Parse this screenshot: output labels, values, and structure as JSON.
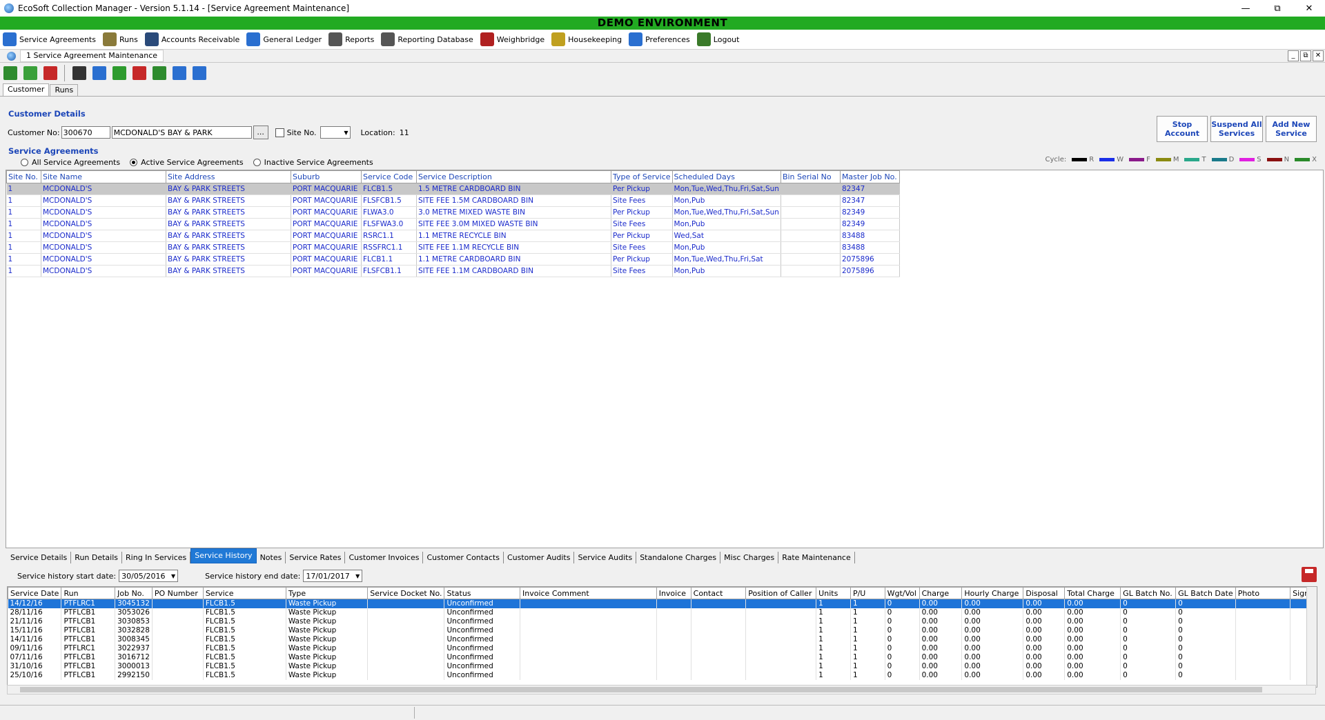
{
  "window": {
    "title": "EcoSoft Collection Manager - Version 5.1.14 - [Service Agreement Maintenance]"
  },
  "banner": "DEMO ENVIRONMENT",
  "menu": [
    {
      "label": "Service Agreements",
      "icon": "calendar-icon",
      "color": "#2a6fd0"
    },
    {
      "label": "Runs",
      "icon": "clipboard-icon",
      "color": "#8a7a3a"
    },
    {
      "label": "Accounts Receivable",
      "icon": "people-money-icon",
      "color": "#2a4a7a"
    },
    {
      "label": "General Ledger",
      "icon": "ledger-icon",
      "color": "#2a6fd0"
    },
    {
      "label": "Reports",
      "icon": "printer-icon",
      "color": "#555555"
    },
    {
      "label": "Reporting Database",
      "icon": "database-printer-icon",
      "color": "#555555"
    },
    {
      "label": "Weighbridge",
      "icon": "truck-icon",
      "color": "#b02020"
    },
    {
      "label": "Housekeeping",
      "icon": "gears-icon",
      "color": "#c0a020"
    },
    {
      "label": "Preferences",
      "icon": "checklist-icon",
      "color": "#2a6fd0"
    },
    {
      "label": "Logout",
      "icon": "exit-icon",
      "color": "#3a7a2a"
    }
  ],
  "mdi": {
    "tab": "1 Service Agreement Maintenance"
  },
  "toolbar": [
    {
      "icon": "add-customer-icon",
      "color": "#2e8b2e"
    },
    {
      "icon": "approve-icon",
      "color": "#3aa03a"
    },
    {
      "icon": "delete-icon",
      "color": "#c62828"
    },
    {
      "icon": "find-icon",
      "color": "#333333"
    },
    {
      "icon": "search-records-icon",
      "color": "#2a6fd0"
    },
    {
      "icon": "refresh-icon",
      "color": "#2e9b2e"
    },
    {
      "icon": "save-icon",
      "color": "#c62828"
    },
    {
      "icon": "edit-icon",
      "color": "#2e8b2e"
    },
    {
      "icon": "export-icon",
      "color": "#2a6fd0"
    },
    {
      "icon": "screen-icon",
      "color": "#2a6fd0"
    }
  ],
  "subtabs": [
    "Customer",
    "Runs"
  ],
  "customer": {
    "section": "Customer Details",
    "no_label": "Customer No:",
    "no_value": "300670",
    "name_value": "MCDONALD'S BAY & PARK",
    "browse_label": "...",
    "site_label": "Site No.",
    "location_label": "Location:",
    "location_value": "11"
  },
  "actions": {
    "stop": "Stop Account",
    "suspend": "Suspend All Services",
    "add": "Add New Service"
  },
  "agreements": {
    "section": "Service Agreements",
    "filters": [
      "All Service Agreements",
      "Active Service Agreements",
      "Inactive Service Agreements"
    ],
    "cycle_label": "Cycle:",
    "cycle": [
      {
        "code": "R",
        "color": "#000000"
      },
      {
        "code": "W",
        "color": "#1a2ee8"
      },
      {
        "code": "F",
        "color": "#8a1a8a"
      },
      {
        "code": "M",
        "color": "#8a8a10"
      },
      {
        "code": "T",
        "color": "#2aa88a"
      },
      {
        "code": "D",
        "color": "#1a7a8a"
      },
      {
        "code": "S",
        "color": "#e020e0"
      },
      {
        "code": "N",
        "color": "#8a1010"
      },
      {
        "code": "X",
        "color": "#2a8a2a"
      }
    ],
    "columns": [
      "Site No.",
      "Site Name",
      "Site Address",
      "Suburb",
      "Service Code",
      "Service Description",
      "Type of Service",
      "Scheduled Days",
      "Bin Serial No",
      "Master Job No."
    ],
    "rows": [
      [
        "1",
        "MCDONALD'S",
        "BAY & PARK STREETS",
        "PORT MACQUARIE",
        "FLCB1.5",
        "1.5 METRE CARDBOARD BIN",
        "Per Pickup",
        "Mon,Tue,Wed,Thu,Fri,Sat,Sun",
        "",
        "82347"
      ],
      [
        "1",
        "MCDONALD'S",
        "BAY & PARK STREETS",
        "PORT MACQUARIE",
        "FLSFCB1.5",
        "SITE FEE 1.5M CARDBOARD BIN",
        "Site Fees",
        "Mon,Pub",
        "",
        "82347"
      ],
      [
        "1",
        "MCDONALD'S",
        "BAY & PARK STREETS",
        "PORT MACQUARIE",
        "FLWA3.0",
        "3.0 METRE MIXED WASTE BIN",
        "Per Pickup",
        "Mon,Tue,Wed,Thu,Fri,Sat,Sun",
        "",
        "82349"
      ],
      [
        "1",
        "MCDONALD'S",
        "BAY & PARK STREETS",
        "PORT MACQUARIE",
        "FLSFWA3.0",
        "SITE FEE 3.0M MIXED WASTE BIN",
        "Site Fees",
        "Mon,Pub",
        "",
        "82349"
      ],
      [
        "1",
        "MCDONALD'S",
        "BAY & PARK STREETS",
        "PORT MACQUARIE",
        "RSRC1.1",
        "1.1 METRE RECYCLE BIN",
        "Per Pickup",
        "Wed,Sat",
        "",
        "83488"
      ],
      [
        "1",
        "MCDONALD'S",
        "BAY & PARK STREETS",
        "PORT MACQUARIE",
        "RSSFRC1.1",
        "SITE FEE 1.1M RECYCLE BIN",
        "Site Fees",
        "Mon,Pub",
        "",
        "83488"
      ],
      [
        "1",
        "MCDONALD'S",
        "BAY & PARK STREETS",
        "PORT MACQUARIE",
        "FLCB1.1",
        "1.1 METRE CARDBOARD BIN",
        "Per Pickup",
        "Mon,Tue,Wed,Thu,Fri,Sat",
        "",
        "2075896"
      ],
      [
        "1",
        "MCDONALD'S",
        "BAY & PARK STREETS",
        "PORT MACQUARIE",
        "FLSFCB1.1",
        "SITE FEE 1.1M CARDBOARD BIN",
        "Site Fees",
        "Mon,Pub",
        "",
        "2075896"
      ]
    ]
  },
  "bottom_tabs": [
    "Service Details",
    "Run Details",
    "Ring In Services",
    "Service History",
    "Notes",
    "Service Rates",
    "Customer Invoices",
    "Customer Contacts",
    "Customer Audits",
    "Service Audits",
    "Standalone Charges",
    "Misc Charges",
    "Rate Maintenance"
  ],
  "history": {
    "start_label": "Service history start date:",
    "start_value": "30/05/2016",
    "end_label": "Service history end date:",
    "end_value": "17/01/2017",
    "columns": [
      "Service Date",
      "Run",
      "Job No.",
      "PO Number",
      "Service",
      "Type",
      "Service Docket No.",
      "Status",
      "Invoice Comment",
      "Invoice",
      "Contact",
      "Position of Caller",
      "Units",
      "P/U",
      "Wgt/Vol",
      "Charge",
      "Hourly Charge",
      "Disposal",
      "Total Charge",
      "GL Batch No.",
      "GL Batch Date",
      "Photo",
      "Signa"
    ],
    "rows": [
      [
        "14/12/16",
        "PTFLRC1",
        "3045132",
        "",
        "FLCB1.5",
        "Waste Pickup",
        "",
        "Unconfirmed",
        "",
        "",
        "",
        "",
        "1",
        "1",
        "0",
        "0.00",
        "0.00",
        "0.00",
        "0.00",
        "0",
        "0",
        "",
        ""
      ],
      [
        "28/11/16",
        "PTFLCB1",
        "3053026",
        "",
        "FLCB1.5",
        "Waste Pickup",
        "",
        "Unconfirmed",
        "",
        "",
        "",
        "",
        "1",
        "1",
        "0",
        "0.00",
        "0.00",
        "0.00",
        "0.00",
        "0",
        "0",
        "",
        ""
      ],
      [
        "21/11/16",
        "PTFLCB1",
        "3030853",
        "",
        "FLCB1.5",
        "Waste Pickup",
        "",
        "Unconfirmed",
        "",
        "",
        "",
        "",
        "1",
        "1",
        "0",
        "0.00",
        "0.00",
        "0.00",
        "0.00",
        "0",
        "0",
        "",
        ""
      ],
      [
        "15/11/16",
        "PTFLCB1",
        "3032828",
        "",
        "FLCB1.5",
        "Waste Pickup",
        "",
        "Unconfirmed",
        "",
        "",
        "",
        "",
        "1",
        "1",
        "0",
        "0.00",
        "0.00",
        "0.00",
        "0.00",
        "0",
        "0",
        "",
        ""
      ],
      [
        "14/11/16",
        "PTFLCB1",
        "3008345",
        "",
        "FLCB1.5",
        "Waste Pickup",
        "",
        "Unconfirmed",
        "",
        "",
        "",
        "",
        "1",
        "1",
        "0",
        "0.00",
        "0.00",
        "0.00",
        "0.00",
        "0",
        "0",
        "",
        ""
      ],
      [
        "09/11/16",
        "PTFLRC1",
        "3022937",
        "",
        "FLCB1.5",
        "Waste Pickup",
        "",
        "Unconfirmed",
        "",
        "",
        "",
        "",
        "1",
        "1",
        "0",
        "0.00",
        "0.00",
        "0.00",
        "0.00",
        "0",
        "0",
        "",
        ""
      ],
      [
        "07/11/16",
        "PTFLCB1",
        "3016712",
        "",
        "FLCB1.5",
        "Waste Pickup",
        "",
        "Unconfirmed",
        "",
        "",
        "",
        "",
        "1",
        "1",
        "0",
        "0.00",
        "0.00",
        "0.00",
        "0.00",
        "0",
        "0",
        "",
        ""
      ],
      [
        "31/10/16",
        "PTFLCB1",
        "3000013",
        "",
        "FLCB1.5",
        "Waste Pickup",
        "",
        "Unconfirmed",
        "",
        "",
        "",
        "",
        "1",
        "1",
        "0",
        "0.00",
        "0.00",
        "0.00",
        "0.00",
        "0",
        "0",
        "",
        ""
      ],
      [
        "25/10/16",
        "PTFLCB1",
        "2992150",
        "",
        "FLCB1.5",
        "Waste Pickup",
        "",
        "Unconfirmed",
        "",
        "",
        "",
        "",
        "1",
        "1",
        "0",
        "0.00",
        "0.00",
        "0.00",
        "0.00",
        "0",
        "0",
        "",
        ""
      ]
    ]
  }
}
